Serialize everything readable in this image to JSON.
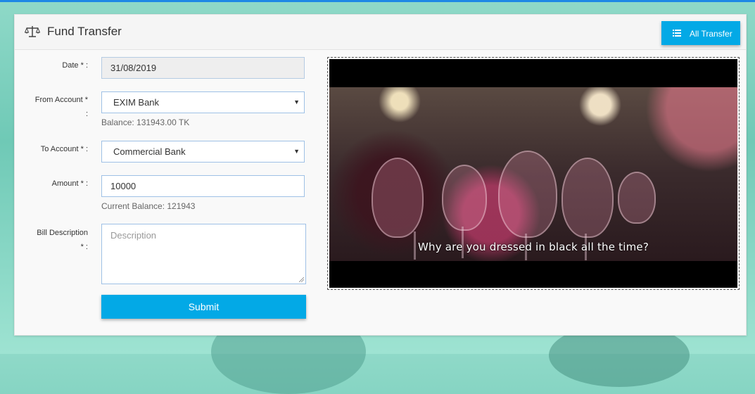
{
  "header": {
    "title": "Fund Transfer",
    "all_transfer_label": "All Transfer"
  },
  "form": {
    "date_label": "Date * :",
    "date_value": "31/08/2019",
    "from_label_1": "From Account *",
    "from_label_2": ":",
    "from_value": "EXIM Bank",
    "from_helper": "Balance: 131943.00 TK",
    "to_label": "To Account * :",
    "to_value": "Commercial Bank",
    "amount_label": "Amount * :",
    "amount_value": "10000",
    "amount_helper": "Current Balance: 121943",
    "desc_label_1": "Bill Description",
    "desc_label_2": "* :",
    "desc_placeholder": "Description",
    "submit_label": "Submit"
  },
  "video": {
    "subtitle": "Why are you dressed in black all the time?"
  },
  "colors": {
    "accent": "#03a9e6",
    "field_border": "#9fc1e6"
  }
}
